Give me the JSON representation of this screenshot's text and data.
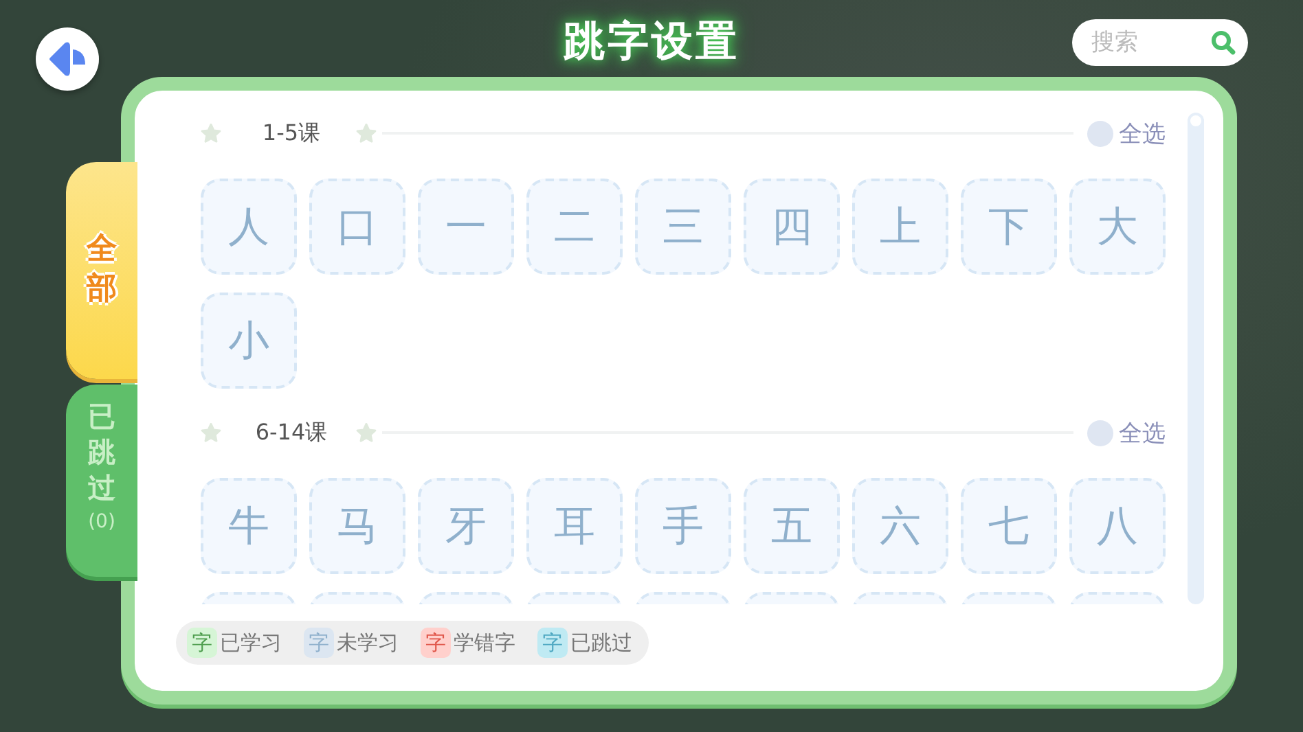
{
  "title": "跳字设置",
  "search": {
    "placeholder": "搜索"
  },
  "tabs": [
    {
      "label": "全部",
      "selected": true
    },
    {
      "label": "已跳过",
      "count": "(0)",
      "selected": false
    }
  ],
  "sections": [
    {
      "title": "1-5课",
      "select_all": {
        "label": "全选",
        "checked": false
      },
      "characters": [
        {
          "char": "人"
        },
        {
          "char": "口"
        },
        {
          "char": "一"
        },
        {
          "char": "二"
        },
        {
          "char": "三"
        },
        {
          "char": "四"
        },
        {
          "char": "上"
        },
        {
          "char": "下"
        },
        {
          "char": "大"
        },
        {
          "char": "小"
        }
      ]
    },
    {
      "title": "6-14课",
      "select_all": {
        "label": "全选",
        "checked": false
      },
      "characters": [
        {
          "char": "牛"
        },
        {
          "char": "马"
        },
        {
          "char": "牙"
        },
        {
          "char": "耳"
        },
        {
          "char": "手"
        },
        {
          "char": "五"
        },
        {
          "char": "六"
        },
        {
          "char": "七"
        },
        {
          "char": "八"
        }
      ]
    }
  ],
  "legend": [
    {
      "swatch": "字",
      "label": "已学习",
      "color": "#d6f5d6"
    },
    {
      "swatch": "字",
      "label": "未学习",
      "color": "#dce6f1"
    },
    {
      "swatch": "字",
      "label": "学错字",
      "color": "#ffd0cc"
    },
    {
      "swatch": "字",
      "label": "已跳过",
      "color": "#bfeaf3"
    }
  ]
}
